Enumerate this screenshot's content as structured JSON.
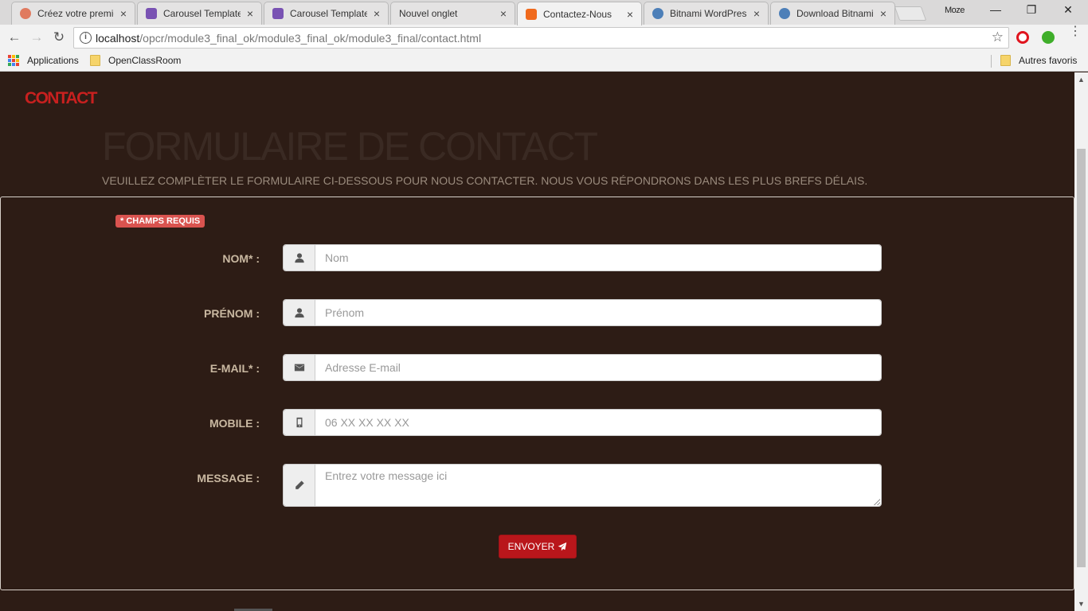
{
  "browser": {
    "tabs": [
      {
        "title": "Créez votre premie",
        "favicon_color": "#e07a5f",
        "active": false
      },
      {
        "title": "Carousel Template",
        "favicon_color": "#7952b3",
        "active": false
      },
      {
        "title": "Carousel Template",
        "favicon_color": "#7952b3",
        "active": false
      },
      {
        "title": "Nouvel onglet",
        "favicon_color": "",
        "active": false
      },
      {
        "title": "Contactez-Nous",
        "favicon_color": "#f06a1d",
        "active": true
      },
      {
        "title": "Bitnami WordPres",
        "favicon_color": "#4d7fb8",
        "active": false
      },
      {
        "title": "Download Bitnami",
        "favicon_color": "#4d7fb8",
        "active": false
      }
    ],
    "tab_close": "×",
    "profile": "Moze",
    "window": {
      "minimize": "—",
      "maximize": "❐",
      "close": "✕"
    },
    "nav": {
      "back": "←",
      "forward": "→",
      "reload": "↻"
    },
    "url_host": "localhost",
    "url_path": "/opcr/module3_final_ok/module3_final_ok/module3_final/contact.html",
    "info_glyph": "i",
    "star_glyph": "☆",
    "menu_glyph": "⋮",
    "bookmarks": {
      "apps": "Applications",
      "folder1": "OpenClassRoom",
      "other": "Autres favoris"
    }
  },
  "page": {
    "brand": "CONTACT",
    "title": "FORMULAIRE DE CONTACT",
    "subtitle": "VEUILLEZ COMPLÈTER LE FORMULAIRE CI-DESSOUS POUR NOUS CONTACTER. NOUS VOUS RÉPONDRONS DANS LES PLUS BREFS DÉLAIS.",
    "required_badge": "* CHAMPS REQUIS",
    "form": {
      "nom": {
        "label": "NOM* :",
        "placeholder": "Nom",
        "icon": "user-icon"
      },
      "prenom": {
        "label": "PRÉNOM :",
        "placeholder": "Prénom",
        "icon": "user-icon"
      },
      "email": {
        "label": "E-MAIL* :",
        "placeholder": "Adresse E-mail",
        "icon": "envelope-icon"
      },
      "mobile": {
        "label": "MOBILE :",
        "placeholder": "06 XX XX XX XX",
        "icon": "phone-icon"
      },
      "message": {
        "label": "MESSAGE :",
        "placeholder": "Entrez votre message ici",
        "icon": "pencil-icon"
      }
    },
    "submit_label": "ENVOYER"
  },
  "colors": {
    "background": "#2d1c15",
    "brand": "#c8201f",
    "button": "#b9161b",
    "badge": "#d9534f",
    "label": "#c9b8a1"
  }
}
